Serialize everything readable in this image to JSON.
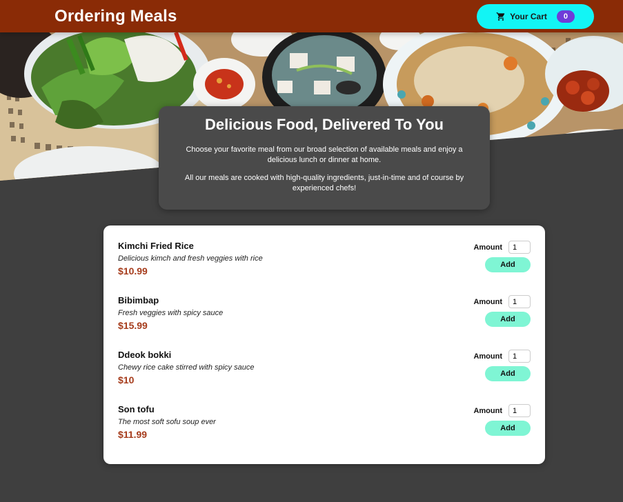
{
  "header": {
    "title": "Ordering Meals",
    "cart_label": "Your Cart",
    "cart_count": "0"
  },
  "summary": {
    "title": "Delicious Food, Delivered To You",
    "paragraph_1": "Choose your favorite meal from our broad selection of available meals and enjoy a delicious lunch or dinner at home.",
    "paragraph_2": "All our meals are cooked with high-quality ingredients, just-in-time and of course by experienced chefs!"
  },
  "meals": [
    {
      "name": "Kimchi Fried Rice",
      "description": "Delicious kimch and fresh veggies with rice",
      "price": "$10.99",
      "amount_label": "Amount",
      "amount_value": "1",
      "add_label": "Add"
    },
    {
      "name": "Bibimbap",
      "description": "Fresh veggies with spicy sauce",
      "price": "$15.99",
      "amount_label": "Amount",
      "amount_value": "1",
      "add_label": "Add"
    },
    {
      "name": "Ddeok bokki",
      "description": "Chewy rice cake stirred with spicy sauce",
      "price": "$10",
      "amount_label": "Amount",
      "amount_value": "1",
      "add_label": "Add"
    },
    {
      "name": "Son tofu",
      "description": "The most soft sofu soup ever",
      "price": "$11.99",
      "amount_label": "Amount",
      "amount_value": "1",
      "add_label": "Add"
    }
  ],
  "colors": {
    "header_bg": "#8a2b06",
    "cart_button": "#12f5f5",
    "badge": "#6f3cd8",
    "add_button": "#7ff5d4",
    "price": "#a63c1c",
    "page_bg": "#3f3f3f"
  },
  "icons": {
    "cart": "cart-icon"
  }
}
